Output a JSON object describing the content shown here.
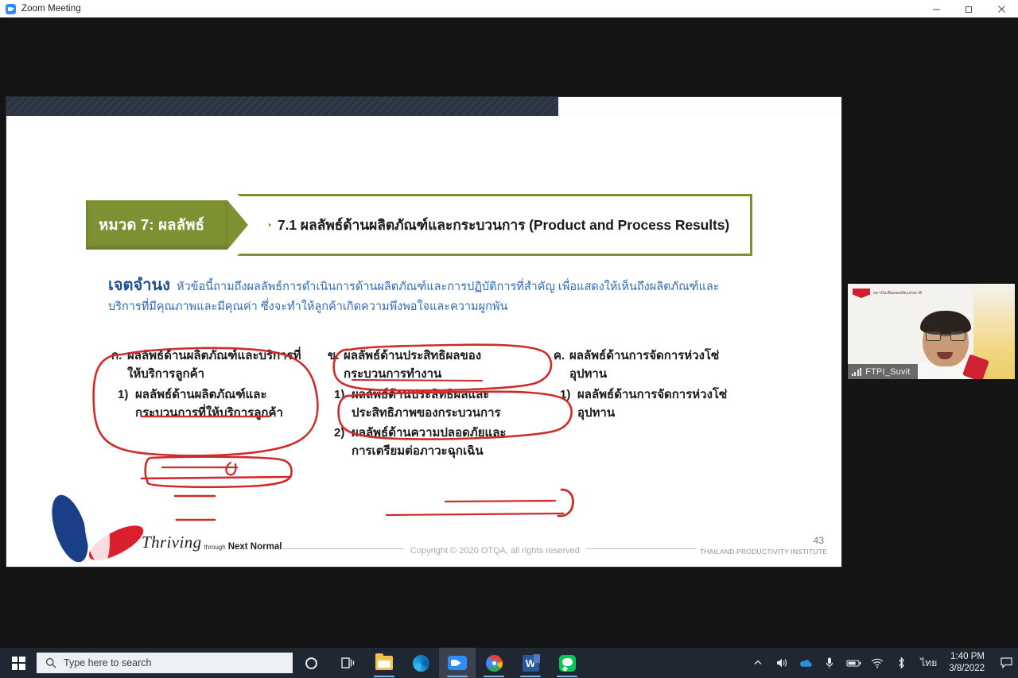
{
  "window": {
    "title": "Zoom Meeting",
    "app_icon": "zoom-icon",
    "controls": {
      "minimize": "minimize-icon",
      "maximize": "restore-icon",
      "close": "close-icon"
    }
  },
  "slide": {
    "header": {
      "tab_label": "หมวด 7: ผลลัพธ์",
      "title": "7.1  ผลลัพธ์ด้านผลิตภัณฑ์และกระบวนการ (Product and Process Results)"
    },
    "intent": {
      "label": "เจตจำนง",
      "text": "หัวข้อนี้ถามถึงผลลัพธ์การดำเนินการด้านผลิตภัณฑ์และการปฏิบัติการที่สำคัญ เพื่อแสดงให้เห็นถึงผลิตภัณฑ์และบริการที่มีคุณภาพและมีคุณค่า ซึ่งจะทำให้ลูกค้าเกิดความพึงพอใจและความผูกพัน"
    },
    "columns": [
      {
        "marker": "ก.",
        "heading": "ผลลัพธ์ด้านผลิตภัณฑ์และบริการที่ให้บริการลูกค้า",
        "items": [
          {
            "marker": "1)",
            "text": "ผลลัพธ์ด้านผลิตภัณฑ์และกระบวนการที่ให้บริการลูกค้า"
          }
        ]
      },
      {
        "marker": "ข.",
        "heading": "ผลลัพธ์ด้านประสิทธิผลของกระบวนการทำงาน",
        "items": [
          {
            "marker": "1)",
            "text": "ผลลัพธ์ด้านประสิทธิผลและประสิทธิภาพของกระบวนการ"
          },
          {
            "marker": "2)",
            "text": "ผลลัพธ์ด้านความปลอดภัยและการเตรียมต่อภาวะฉุกเฉิน"
          }
        ]
      },
      {
        "marker": "ค.",
        "heading": "ผลลัพธ์ด้านการจัดการห่วงโซ่อุปทาน",
        "items": [
          {
            "marker": "1)",
            "text": "ผลลัพธ์ด้านการจัดการห่วงโซ่อุปทาน"
          }
        ]
      }
    ],
    "footer": {
      "brand_script": "Thriving",
      "brand_small": "through",
      "brand_bold": "Next Normal",
      "copyright": "Copyright © 2020 OTQA, all rights reserved",
      "institute": "THAILAND PRODUCTIVITY INSTITUTE",
      "page_number": "43"
    },
    "colors": {
      "banner_green": "#7d9133",
      "intent_blue": "#2f6bb5",
      "annotation_red": "#d32b2b"
    }
  },
  "video_tile": {
    "participant_name": "FTPI_Suvit",
    "signal_icon": "signal-bars-icon",
    "background_banner_text": "สถาบันเพิ่มผลผลิตแห่งชาติ"
  },
  "taskbar": {
    "start_icon": "windows-start-icon",
    "search": {
      "icon": "search-icon",
      "placeholder": "Type here to search"
    },
    "cortana_icon": "cortana-icon",
    "task_view_icon": "task-view-icon",
    "apps": [
      {
        "name": "file-explorer",
        "label": "File Explorer",
        "running": true,
        "active": false
      },
      {
        "name": "microsoft-edge",
        "label": "Microsoft Edge",
        "running": false,
        "active": false
      },
      {
        "name": "zoom",
        "label": "Zoom",
        "running": true,
        "active": true
      },
      {
        "name": "google-chrome",
        "label": "Google Chrome",
        "running": true,
        "active": false
      },
      {
        "name": "microsoft-word",
        "label": "Microsoft Word",
        "running": true,
        "active": false
      },
      {
        "name": "line",
        "label": "LINE",
        "running": true,
        "active": false
      }
    ],
    "tray": {
      "chevron": "show-hidden-icons-icon",
      "volume": "volume-icon",
      "onedrive": "onedrive-icon",
      "microphone": "microphone-icon",
      "battery": "battery-icon",
      "wifi": "wifi-icon",
      "bluetooth": "bluetooth-icon",
      "language": "ไทย",
      "time": "1:40 PM",
      "date": "3/8/2022",
      "action_center": "action-center-icon"
    }
  }
}
